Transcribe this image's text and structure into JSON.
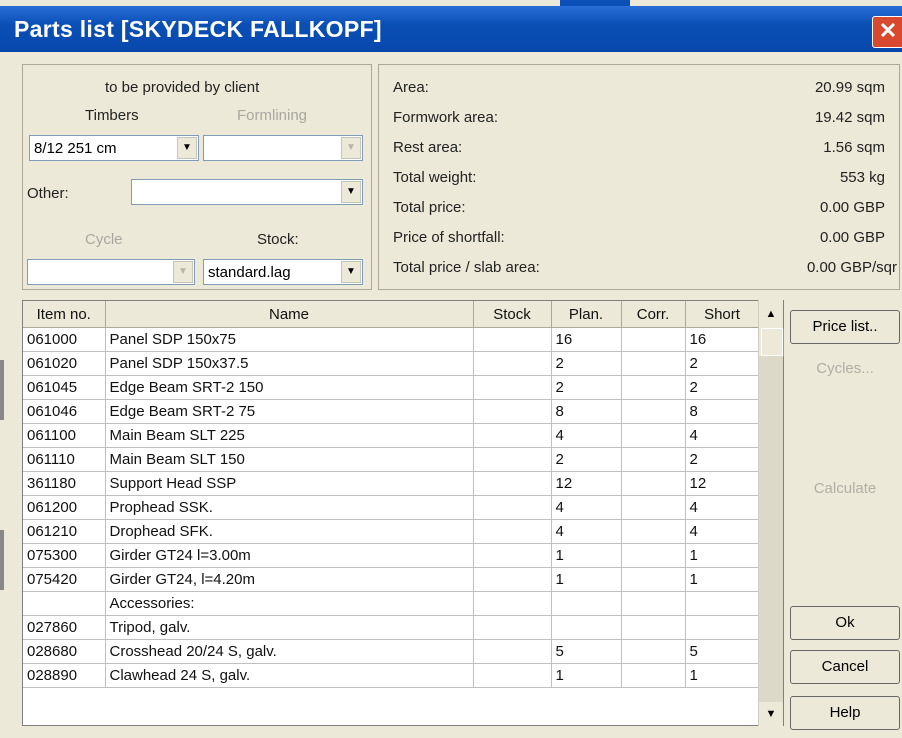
{
  "window": {
    "title": "Parts list [SKYDECK FALLKOPF]",
    "close": "✕"
  },
  "client": {
    "header": "to be provided by client",
    "timbers_label": "Timbers",
    "formlining_label": "Formlining",
    "timbers_value": "8/12 251 cm",
    "formlining_value": "",
    "other_label": "Other:",
    "other_value": "",
    "cycle_label": "Cycle",
    "cycle_value": "",
    "stock_label": "Stock:",
    "stock_value": "standard.lag"
  },
  "info": [
    {
      "key": "Area:",
      "value": "20.99 sqm"
    },
    {
      "key": "Formwork area:",
      "value": "19.42 sqm"
    },
    {
      "key": "Rest area:",
      "value": "1.56 sqm"
    },
    {
      "key": "Total weight:",
      "value": "553 kg"
    },
    {
      "key": "Total price:",
      "value": "0.00 GBP"
    },
    {
      "key": "Price of shortfall:",
      "value": "0.00 GBP"
    },
    {
      "key": "Total price / slab area:",
      "value": "0.00 GBP/sqr"
    }
  ],
  "table": {
    "headers": [
      "Item no.",
      "Name",
      "Stock",
      "Plan.",
      "Corr.",
      "Short"
    ],
    "rows": [
      [
        "061000",
        "Panel SDP 150x75",
        "",
        "16",
        "",
        "16"
      ],
      [
        "061020",
        "Panel SDP 150x37.5",
        "",
        "2",
        "",
        "2"
      ],
      [
        "061045",
        "Edge Beam SRT-2 150",
        "",
        "2",
        "",
        "2"
      ],
      [
        "061046",
        "Edge Beam SRT-2 75",
        "",
        "8",
        "",
        "8"
      ],
      [
        "061100",
        "Main Beam SLT 225",
        "",
        "4",
        "",
        "4"
      ],
      [
        "061110",
        "Main Beam SLT 150",
        "",
        "2",
        "",
        "2"
      ],
      [
        "361180",
        "Support Head SSP",
        "",
        "12",
        "",
        "12"
      ],
      [
        "061200",
        "Prophead SSK.",
        "",
        "4",
        "",
        "4"
      ],
      [
        "061210",
        "Drophead SFK.",
        "",
        "4",
        "",
        "4"
      ],
      [
        "075300",
        "Girder GT24 l=3.00m",
        "",
        "1",
        "",
        "1"
      ],
      [
        "075420",
        "Girder GT24, l=4.20m",
        "",
        "1",
        "",
        "1"
      ],
      [
        "",
        "Accessories:",
        "",
        "",
        "",
        ""
      ],
      [
        "027860",
        "Tripod, galv.",
        "",
        "",
        "",
        ""
      ],
      [
        "028680",
        "Crosshead 20/24 S, galv.",
        "",
        "5",
        "",
        "5"
      ],
      [
        "028890",
        "Clawhead 24 S, galv.",
        "",
        "1",
        "",
        "1"
      ]
    ]
  },
  "buttons": {
    "price_list": "Price list..",
    "cycles": "Cycles...",
    "calculate": "Calculate",
    "ok": "Ok",
    "cancel": "Cancel",
    "help": "Help"
  }
}
